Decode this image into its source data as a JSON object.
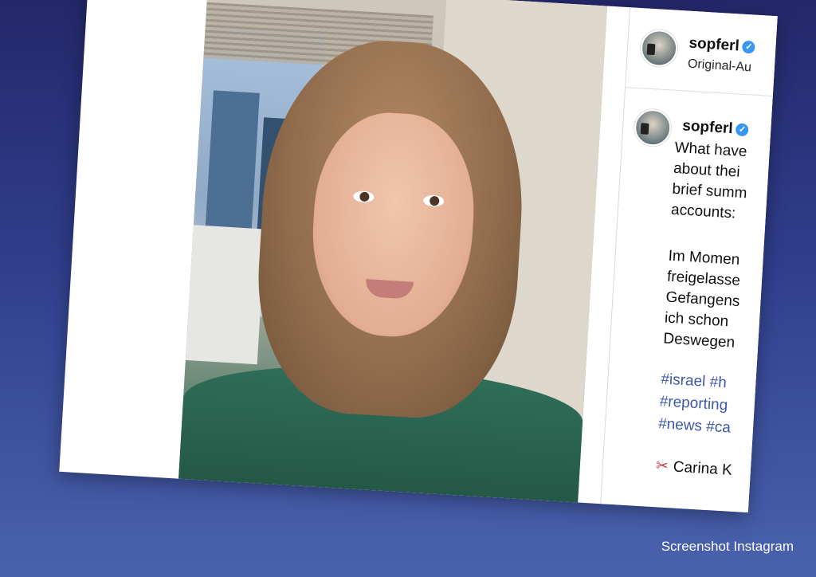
{
  "post": {
    "username": "sopferl",
    "audio_label": "Original-Au",
    "caption_lines": [
      "What have",
      "about thei",
      "brief summ",
      "accounts:"
    ],
    "german_lines": [
      "Im Momen",
      "freigelasse",
      "Gefangens",
      "ich schon",
      "Deswegen"
    ],
    "hashtag_lines": [
      "#israel #h",
      "#reporting",
      "#news #ca"
    ],
    "credit_line": "Carina K"
  },
  "icons": {
    "verified": "verified-badge-icon",
    "scissors": "scissors-icon"
  },
  "colors": {
    "accent": "#3897f0",
    "hashtag": "#3d58a6",
    "scissors": "#d83a3a"
  },
  "footer": {
    "source": "Screenshot Instagram"
  }
}
